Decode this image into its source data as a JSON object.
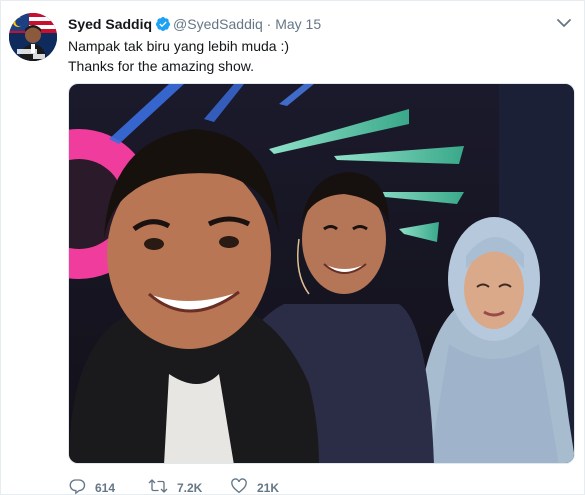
{
  "tweet": {
    "author_name": "Syed Saddiq",
    "handle": "@SyedSaddiq",
    "separator": "·",
    "date": "May 15",
    "text_lines": [
      "Nampak tak biru yang lebih muda :)",
      "Thanks for the amazing show."
    ],
    "actions": {
      "reply_count": "614",
      "retweet_count": "7.2K",
      "like_count": "21K"
    }
  },
  "icons": {
    "verified": "verified-badge-icon",
    "caret": "chevron-down-icon",
    "reply": "reply-icon",
    "retweet": "retweet-icon",
    "like": "heart-icon"
  },
  "colors": {
    "verified": "#1da1f2",
    "secondary_text": "#657786",
    "primary_text": "#14171a"
  }
}
